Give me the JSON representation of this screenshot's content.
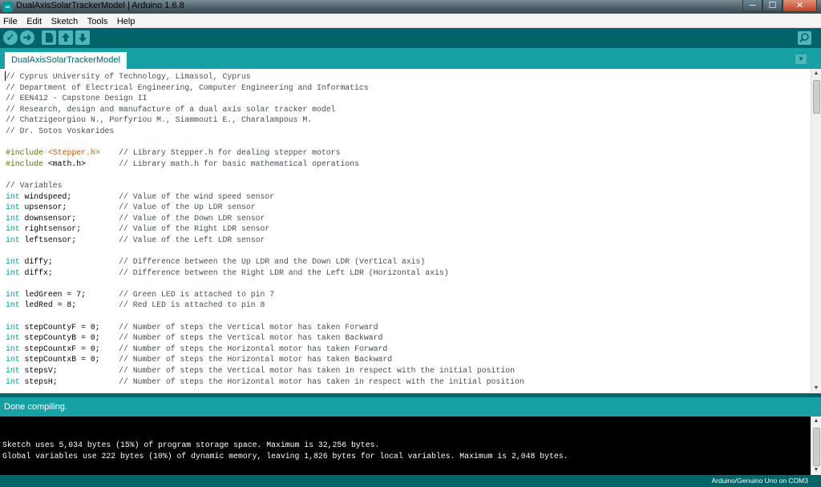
{
  "window": {
    "title": "DualAxisSolarTrackerModel | Arduino 1.6.8",
    "app_icon": "∞",
    "controls": [
      "─",
      "☐",
      "✕"
    ]
  },
  "menu": [
    "File",
    "Edit",
    "Sketch",
    "Tools",
    "Help"
  ],
  "toolbar": {
    "verify_icon": "✓",
    "upload_icon": "➜"
  },
  "tabs": [
    {
      "label": "DualAxisSolarTrackerModel"
    }
  ],
  "tab_menu_icon": "▼",
  "editor": {
    "lines": [
      [
        {
          "t": "// Cyprus University of Technology, Limassol, Cyprus",
          "c": "com"
        }
      ],
      [
        {
          "t": "// Department of Electrical Engineering, Computer Engineering and Informatics",
          "c": "com"
        }
      ],
      [
        {
          "t": "// EEN412 - Capstone Design II",
          "c": "com"
        }
      ],
      [
        {
          "t": "// Research, design and manufacture of a dual axis solar tracker model",
          "c": "com"
        }
      ],
      [
        {
          "t": "// Chatzigeorgiou N., Porfyriou M., Siammouti E., Charalampous M.",
          "c": "com"
        }
      ],
      [
        {
          "t": "// Dr. Sotos Voskarides",
          "c": "com"
        }
      ],
      [],
      [
        {
          "t": "#include",
          "c": "pp"
        },
        {
          "t": " ",
          "c": "code"
        },
        {
          "t": "<Stepper.h>",
          "c": "lib"
        },
        {
          "t": "    // Library Stepper.h for dealing stepper motors",
          "c": "com"
        }
      ],
      [
        {
          "t": "#include",
          "c": "pp"
        },
        {
          "t": " <math.h>       ",
          "c": "code"
        },
        {
          "t": "// Library math.h for basic mathematical operations",
          "c": "com"
        }
      ],
      [],
      [
        {
          "t": "// Variables",
          "c": "com"
        }
      ],
      [
        {
          "t": "int",
          "c": "kw"
        },
        {
          "t": " windspeed;          ",
          "c": "code"
        },
        {
          "t": "// Value of the wind speed sensor",
          "c": "com"
        }
      ],
      [
        {
          "t": "int",
          "c": "kw"
        },
        {
          "t": " upsensor;           ",
          "c": "code"
        },
        {
          "t": "// Value of the Up LDR sensor",
          "c": "com"
        }
      ],
      [
        {
          "t": "int",
          "c": "kw"
        },
        {
          "t": " downsensor;         ",
          "c": "code"
        },
        {
          "t": "// Value of the Down LDR sensor",
          "c": "com"
        }
      ],
      [
        {
          "t": "int",
          "c": "kw"
        },
        {
          "t": " rightsensor;        ",
          "c": "code"
        },
        {
          "t": "// Value of the Right LDR sensor",
          "c": "com"
        }
      ],
      [
        {
          "t": "int",
          "c": "kw"
        },
        {
          "t": " leftsensor;         ",
          "c": "code"
        },
        {
          "t": "// Value of the Left LDR sensor",
          "c": "com"
        }
      ],
      [],
      [
        {
          "t": "int",
          "c": "kw"
        },
        {
          "t": " diffy;              ",
          "c": "code"
        },
        {
          "t": "// Difference between the Up LDR and the Down LDR (Vertical axis)",
          "c": "com"
        }
      ],
      [
        {
          "t": "int",
          "c": "kw"
        },
        {
          "t": " diffx;              ",
          "c": "code"
        },
        {
          "t": "// Difference between the Right LDR and the Left LDR (Horizontal axis)",
          "c": "com"
        }
      ],
      [],
      [
        {
          "t": "int",
          "c": "kw"
        },
        {
          "t": " ledGreen = 7;       ",
          "c": "code"
        },
        {
          "t": "// Green LED is attached to pin 7",
          "c": "com"
        }
      ],
      [
        {
          "t": "int",
          "c": "kw"
        },
        {
          "t": " ledRed = 8;         ",
          "c": "code"
        },
        {
          "t": "// Red LED is attached to pin 8",
          "c": "com"
        }
      ],
      [],
      [
        {
          "t": "int",
          "c": "kw"
        },
        {
          "t": " stepCountyF = 0;    ",
          "c": "code"
        },
        {
          "t": "// Number of steps the Vertical motor has taken Forward",
          "c": "com"
        }
      ],
      [
        {
          "t": "int",
          "c": "kw"
        },
        {
          "t": " stepCountyB = 0;    ",
          "c": "code"
        },
        {
          "t": "// Number of steps the Vertical motor has taken Backward",
          "c": "com"
        }
      ],
      [
        {
          "t": "int",
          "c": "kw"
        },
        {
          "t": " stepCountxF = 0;    ",
          "c": "code"
        },
        {
          "t": "// Number of steps the Horizontal motor has taken Forward",
          "c": "com"
        }
      ],
      [
        {
          "t": "int",
          "c": "kw"
        },
        {
          "t": " stepCountxB = 0;    ",
          "c": "code"
        },
        {
          "t": "// Number of steps the Horizontal motor has taken Backward",
          "c": "com"
        }
      ],
      [
        {
          "t": "int",
          "c": "kw"
        },
        {
          "t": " stepsV;             ",
          "c": "code"
        },
        {
          "t": "// Number of steps the Vertical motor has taken in respect with the initial position",
          "c": "com"
        }
      ],
      [
        {
          "t": "int",
          "c": "kw"
        },
        {
          "t": " stepsH;             ",
          "c": "code"
        },
        {
          "t": "// Number of steps the Horizontal motor has taken in respect with the initial position",
          "c": "com"
        }
      ]
    ]
  },
  "status": {
    "message": "Done compiling."
  },
  "console": {
    "lines": [
      "Sketch uses 5,034 bytes (15%) of program storage space. Maximum is 32,256 bytes.",
      "Global variables use 222 bytes (10%) of dynamic memory, leaving 1,826 bytes for local variables. Maximum is 2,048 bytes."
    ]
  },
  "board": "Arduino/Genuino Uno on COM3",
  "scroll_arrows": {
    "up": "▲",
    "down": "▼"
  },
  "colors": {
    "teal_dark": "#006468",
    "teal": "#17a1a5",
    "teal_light": "#4db7bb",
    "keyword": "#00979c",
    "preprocessor": "#5e6d03",
    "library": "#d35400"
  }
}
